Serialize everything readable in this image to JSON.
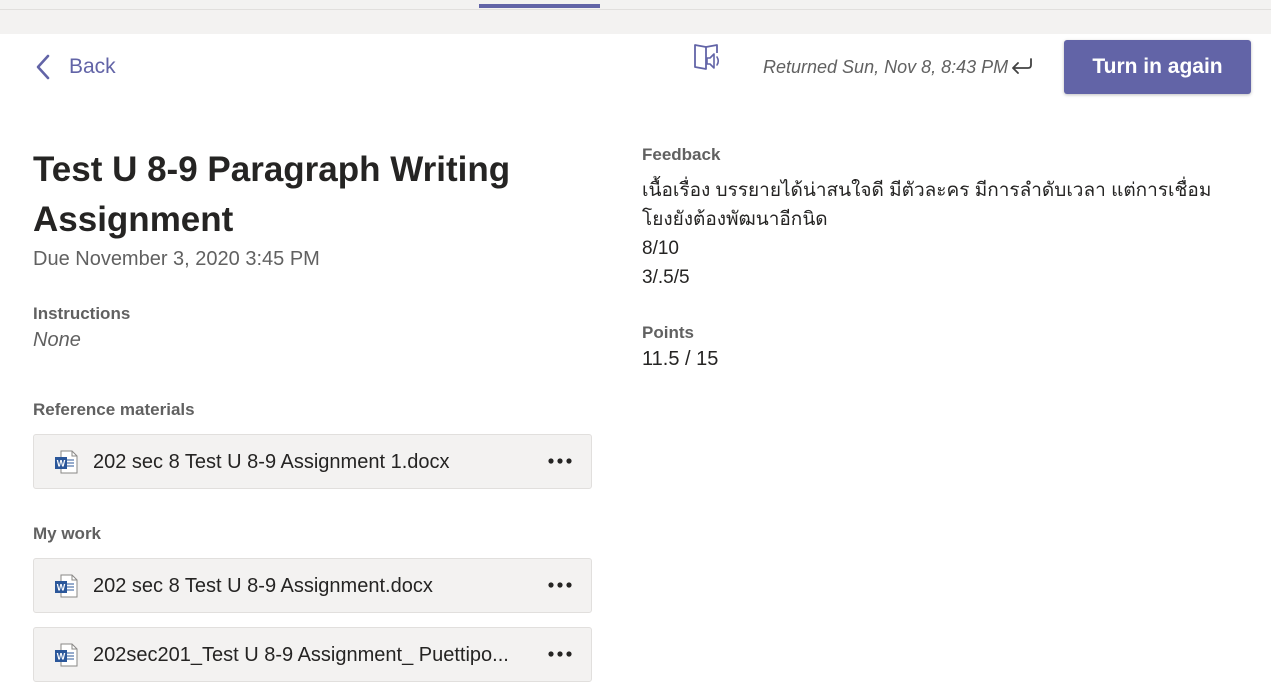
{
  "header": {
    "back_label": "Back",
    "returned_text": "Returned Sun, Nov 8, 8:43 PM",
    "turn_in_label": "Turn in again",
    "accent_color": "#6264a7"
  },
  "assignment": {
    "title": "Test U 8-9 Paragraph Writing Assignment",
    "due": "Due November 3, 2020 3:45 PM",
    "instructions_label": "Instructions",
    "instructions_value": "None",
    "reference_label": "Reference materials",
    "reference_files": [
      {
        "name": "202 sec 8 Test U 8-9 Assignment 1.docx",
        "icon": "word-doc-icon"
      }
    ],
    "my_work_label": "My work",
    "my_work_files": [
      {
        "name": "202 sec 8 Test U 8-9 Assignment.docx",
        "icon": "word-doc-icon"
      },
      {
        "name": "202sec201_Test U 8-9 Assignment_ Puettipo...",
        "icon": "word-doc-icon"
      }
    ]
  },
  "feedback": {
    "label": "Feedback",
    "lines": [
      "เนื้อเรื่อง บรรยายได้น่าสนใจดี มีตัวละคร มีการลำดับเวลา แต่การเชื่อม",
      "โยงยังต้องพัฒนาอีกนิด",
      "8/10",
      "3/.5/5"
    ]
  },
  "points": {
    "label": "Points",
    "value": "11.5 / 15"
  }
}
